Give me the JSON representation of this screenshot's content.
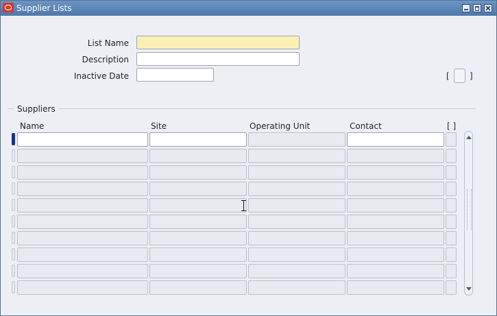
{
  "window": {
    "title": "Supplier Lists"
  },
  "header": {
    "list_name_label": "List Name",
    "list_name_value": "",
    "description_label": "Description",
    "description_value": "",
    "inactive_date_label": "Inactive Date",
    "inactive_date_value": "",
    "flex_left": "[",
    "flex_right": "]"
  },
  "suppliers": {
    "section_title": "Suppliers",
    "columns": {
      "name": "Name",
      "site": "Site",
      "operating_unit": "Operating Unit",
      "contact": "Contact",
      "flex": "[ ]"
    },
    "rows": [
      {
        "name": "",
        "site": "",
        "operating_unit": "",
        "contact": ""
      },
      {
        "name": "",
        "site": "",
        "operating_unit": "",
        "contact": ""
      },
      {
        "name": "",
        "site": "",
        "operating_unit": "",
        "contact": ""
      },
      {
        "name": "",
        "site": "",
        "operating_unit": "",
        "contact": ""
      },
      {
        "name": "",
        "site": "",
        "operating_unit": "",
        "contact": ""
      },
      {
        "name": "",
        "site": "",
        "operating_unit": "",
        "contact": ""
      },
      {
        "name": "",
        "site": "",
        "operating_unit": "",
        "contact": ""
      },
      {
        "name": "",
        "site": "",
        "operating_unit": "",
        "contact": ""
      },
      {
        "name": "",
        "site": "",
        "operating_unit": "",
        "contact": ""
      },
      {
        "name": "",
        "site": "",
        "operating_unit": "",
        "contact": ""
      }
    ],
    "current_row": 0
  },
  "colors": {
    "titlebar": "#4e78a8",
    "required_field": "#fbf0b4",
    "row_indicator_current": "#1b2f8c"
  }
}
